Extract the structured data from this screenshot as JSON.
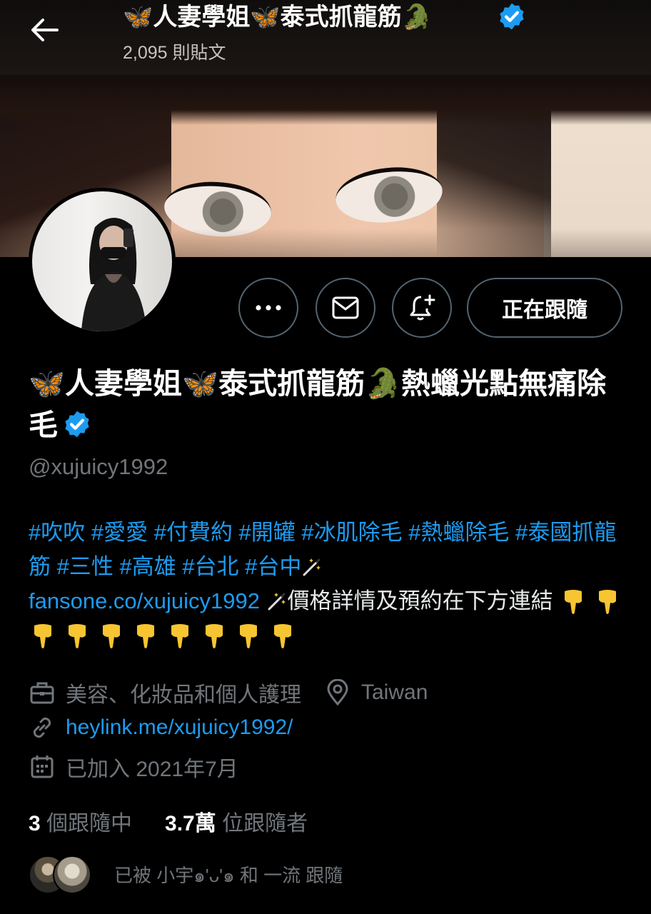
{
  "header": {
    "title": "🦋人妻學姐🦋泰式抓龍筋🐊",
    "post_count": "2,095 則貼文"
  },
  "actions": {
    "follow_label": "正在跟隨"
  },
  "profile": {
    "name": "🦋人妻學姐🦋泰式抓龍筋🐊熱蠟光點無痛除毛",
    "handle": "@xujuicy1992",
    "bio_tags": "#吹吹 #愛愛 #付費約 #開罐 #冰肌除毛 #熱蠟除毛 #泰國抓龍筋 #三性 #高雄 #台北 #台中",
    "bio_link": "fansone.co/xujuicy1992",
    "bio_text": "價格詳情及預約在下方連結",
    "category": "美容、化妝品和個人護理",
    "location": "Taiwan",
    "website": "heylink.me/xujuicy1992/",
    "joined": "已加入 2021年7月"
  },
  "stats": {
    "following_count": "3",
    "following_label": "個跟隨中",
    "followers_count": "3.7萬",
    "followers_label": "位跟隨者"
  },
  "followed_by": "已被 小宇๑'ᴗ'๑ 和 一流 跟隨",
  "colors": {
    "accent": "#1d9bf0",
    "muted": "#71767b",
    "background": "#000000",
    "verified": "#1d9bf0"
  },
  "icons": [
    "back-arrow-icon",
    "more-icon",
    "mail-icon",
    "bell-plus-icon",
    "verified-icon",
    "briefcase-icon",
    "location-pin-icon",
    "link-icon",
    "calendar-icon",
    "magic-wand-icon",
    "pointing-down-icon"
  ]
}
